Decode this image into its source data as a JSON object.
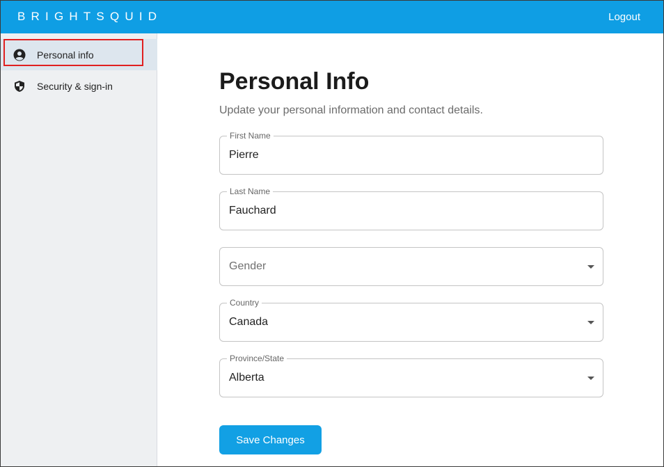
{
  "header": {
    "logo_text": "BRIGHTSQUID",
    "logout_label": "Logout"
  },
  "sidebar": {
    "items": [
      {
        "label": "Personal info",
        "icon": "account-circle-icon",
        "active": true
      },
      {
        "label": "Security & sign-in",
        "icon": "shield-icon",
        "active": false
      }
    ]
  },
  "main": {
    "title": "Personal Info",
    "subtitle": "Update your personal information and contact details.",
    "fields": {
      "first_name": {
        "label": "First Name",
        "value": "Pierre"
      },
      "last_name": {
        "label": "Last Name",
        "value": "Fauchard"
      },
      "gender": {
        "placeholder": "Gender",
        "value": ""
      },
      "country": {
        "label": "Country",
        "value": "Canada"
      },
      "province": {
        "label": "Province/State",
        "value": "Alberta"
      }
    },
    "save_label": "Save Changes"
  },
  "colors": {
    "brand": "#0f9ee4",
    "sidebar_bg": "#eef0f2",
    "active_item_bg": "#dde6ee",
    "highlight": "#e02020"
  }
}
